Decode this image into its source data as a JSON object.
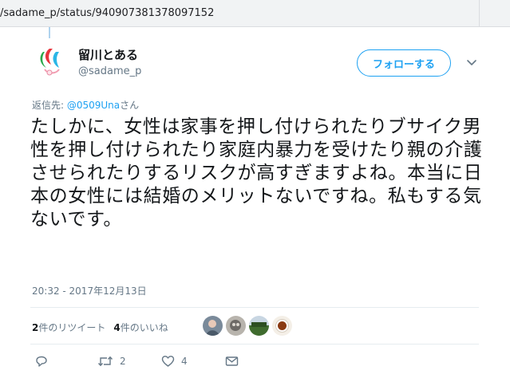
{
  "browser": {
    "url": "/sadame_p/status/940907381378097152"
  },
  "tweet": {
    "author": {
      "display_name": "留川とある",
      "handle": "@sadame_p"
    },
    "follow_label": "フォローする",
    "reply_prefix": "返信先: ",
    "reply_mention": "@0509Una",
    "reply_suffix": "さん",
    "text": "たしかに、女性は家事を押し付けられたりブサイク男性を押し付けられたり家庭内暴力を受けたり親の介護させられたりするリスクが高すぎますよね。本当に日本の女性には結婚のメリットないですね。私もする気ないです。",
    "timestamp": "20:32 - 2017年12月13日",
    "stats": {
      "retweet_count": "2",
      "retweet_label": "件のリツイート",
      "like_count": "4",
      "like_label": "件のいいね"
    },
    "actions": {
      "reply_count": "",
      "retweet_count": "2",
      "like_count": "4"
    }
  },
  "colors": {
    "accent": "#1da1f2",
    "secondary_text": "#657786",
    "primary_text": "#14171a"
  }
}
